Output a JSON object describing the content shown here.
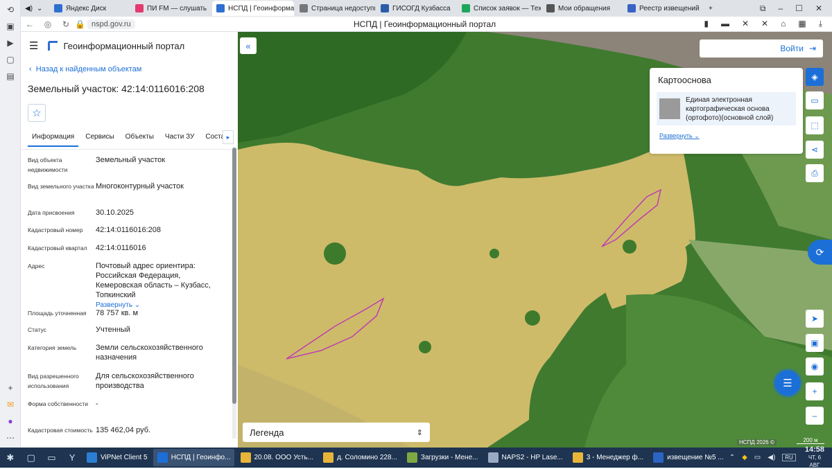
{
  "browser": {
    "tabs": [
      {
        "label": "",
        "fav": "#4a4f57",
        "close": ""
      },
      {
        "label": "Яндекс Диск",
        "fav": "#2f6fd1",
        "close": ""
      },
      {
        "label": "ПИ FM — слушать",
        "fav": "#e43b6f",
        "close": "✕"
      },
      {
        "label": "НСПД | Геоинформа",
        "fav": "#2f6fd1",
        "close": "✕",
        "active": true
      },
      {
        "label": "Страница недоступна",
        "fav": "#777777",
        "close": ""
      },
      {
        "label": "ГИСОГД Кузбасса",
        "fav": "#2a5da8",
        "close": ""
      },
      {
        "label": "Список заявок — Техно",
        "fav": "#1ca85a",
        "close": ""
      },
      {
        "label": "Мои обращения",
        "fav": "#555555",
        "close": ""
      },
      {
        "label": "Реестр извещений",
        "fav": "#3b62c5",
        "close": ""
      }
    ],
    "url": "nspd.gov.ru",
    "page_title": "НСПД | Геоинформационный портал"
  },
  "panel": {
    "app_title": "Геоинформационный портал",
    "back_link": "Назад к найденным объектам",
    "plot_title": "Земельный участок: 42:14:0116016:208",
    "tabs": [
      "Информация",
      "Сервисы",
      "Объекты",
      "Части ЗУ",
      "Состав"
    ],
    "rows": [
      {
        "label": "Вид объекта недвижимости",
        "value": "Земельный участок"
      },
      {
        "label": "Вид земельного участка",
        "value": "Многоконтурный участок"
      },
      {
        "label": "Дата присвоения",
        "value": "30.10.2025"
      },
      {
        "label": "Кадастровый номер",
        "value": "42:14:0116016:208"
      },
      {
        "label": "Кадастровый квартал",
        "value": "42:14:0116016"
      },
      {
        "label": "Адрес",
        "value": "Почтовый адрес ориентира: Российская Федерация, Кемеровская область – Кузбасс, Топкинский",
        "expand": "Развернуть"
      },
      {
        "label": "Площадь уточненная",
        "value": "78 757 кв. м"
      },
      {
        "label": "Статус",
        "value": "Учтенный"
      },
      {
        "label": "Категория земель",
        "value": "Земли сельскохозяйственного назначения"
      },
      {
        "label": "Вид разрешенного использования",
        "value": "Для сельскохозяйственного производства"
      },
      {
        "label": "Форма собственности",
        "value": "-"
      },
      {
        "label": "Кадастровая стоимость",
        "value": "135 462,04 руб."
      }
    ]
  },
  "map": {
    "login": "Войти",
    "basemap_title": "Картооснова",
    "basemap_item": "Единая электронная картографическая основа (ортофото)(основной слой)",
    "basemap_expand": "Развернуть",
    "legend": "Легенда",
    "copyright": "НСПД 2026 ©",
    "scale": "200 м"
  },
  "taskbar": {
    "apps": [
      {
        "label": "ViPNet Client 5",
        "color": "#2a7fd4"
      },
      {
        "label": "НСПД | Геоинфо...",
        "color": "#1c6fd6",
        "active": true
      },
      {
        "label": "20.08. ООО Усть...",
        "color": "#e8b53a"
      },
      {
        "label": "д. Соломино 228...",
        "color": "#e8b53a"
      },
      {
        "label": "Загрузки - Мене...",
        "color": "#7ea842"
      },
      {
        "label": "NAPS2 - HP Lase...",
        "color": "#9aa9c4"
      },
      {
        "label": "3 - Менеджер ф...",
        "color": "#e8b53a"
      },
      {
        "label": "извещение №5 ...",
        "color": "#2b64c4"
      }
    ],
    "lang": "RU",
    "time": "14:58",
    "date": "ЧТ, 6 АВГ"
  }
}
